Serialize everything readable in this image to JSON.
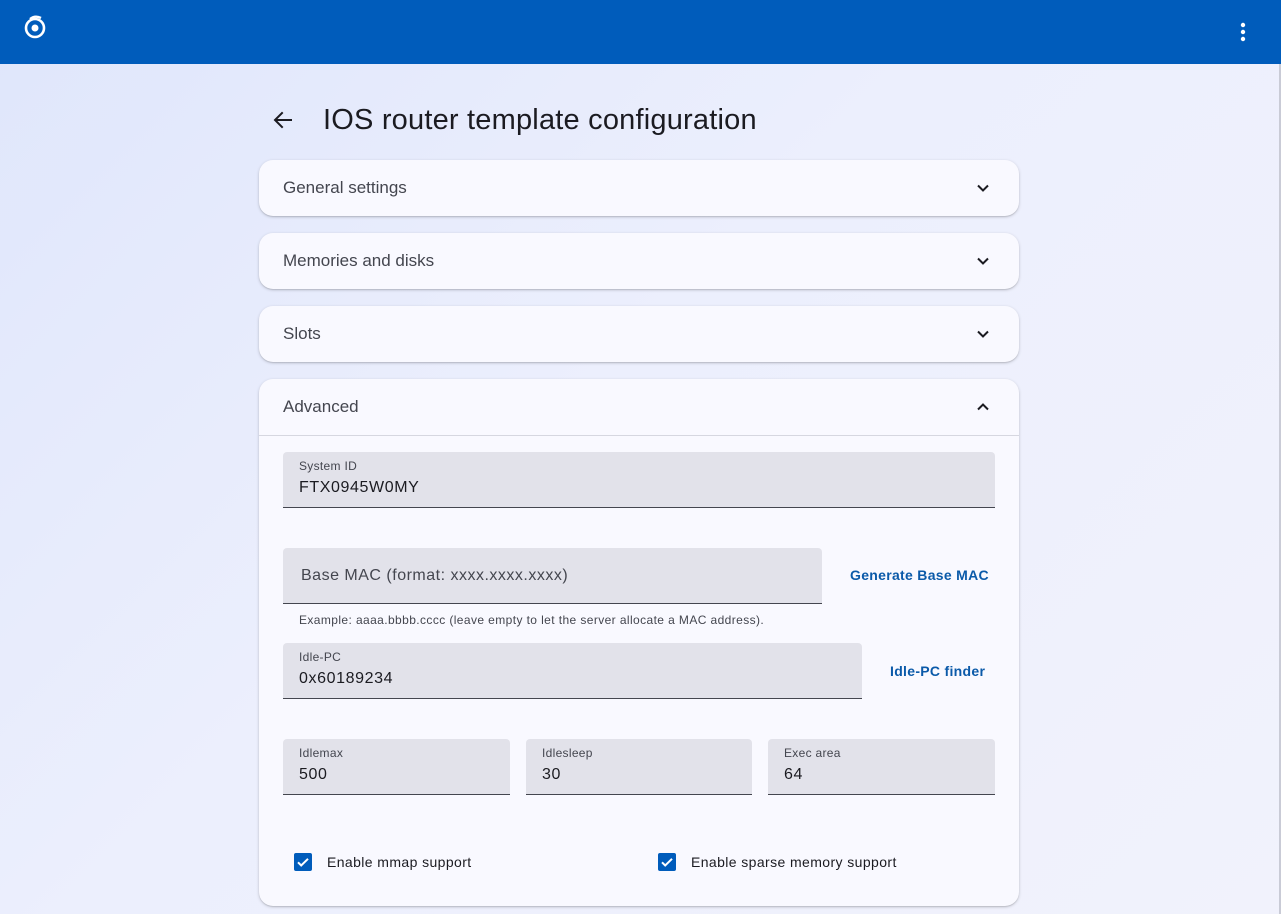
{
  "page": {
    "title": "IOS router template configuration"
  },
  "topbar": {
    "logo_icon": "app-logo-icon",
    "menu_icon": "more-vert-icon",
    "color": "#005cbb"
  },
  "sections": [
    {
      "title": "General settings",
      "expanded": false
    },
    {
      "title": "Memories and disks",
      "expanded": false
    },
    {
      "title": "Slots",
      "expanded": false
    },
    {
      "title": "Advanced",
      "expanded": true
    }
  ],
  "advanced": {
    "system_id": {
      "label": "System ID",
      "value": "FTX0945W0MY"
    },
    "base_mac": {
      "placeholder": "Base MAC (format: xxxx.xxxx.xxxx)",
      "value": "",
      "hint": "Example: aaaa.bbbb.cccc (leave empty to let the server allocate a MAC address).",
      "generate_label": "Generate Base MAC"
    },
    "idle_pc": {
      "label": "Idle-PC",
      "value": "0x60189234",
      "finder_label": "Idle-PC finder"
    },
    "idlemax": {
      "label": "Idlemax",
      "value": "500"
    },
    "idlesleep": {
      "label": "Idlesleep",
      "value": "30"
    },
    "exec_area": {
      "label": "Exec area",
      "value": "64"
    },
    "mmap": {
      "label": "Enable mmap support",
      "checked": true
    },
    "sparse": {
      "label": "Enable sparse memory support",
      "checked": true
    }
  },
  "colors": {
    "accent": "#005cbb",
    "link": "#0b5aa9"
  }
}
